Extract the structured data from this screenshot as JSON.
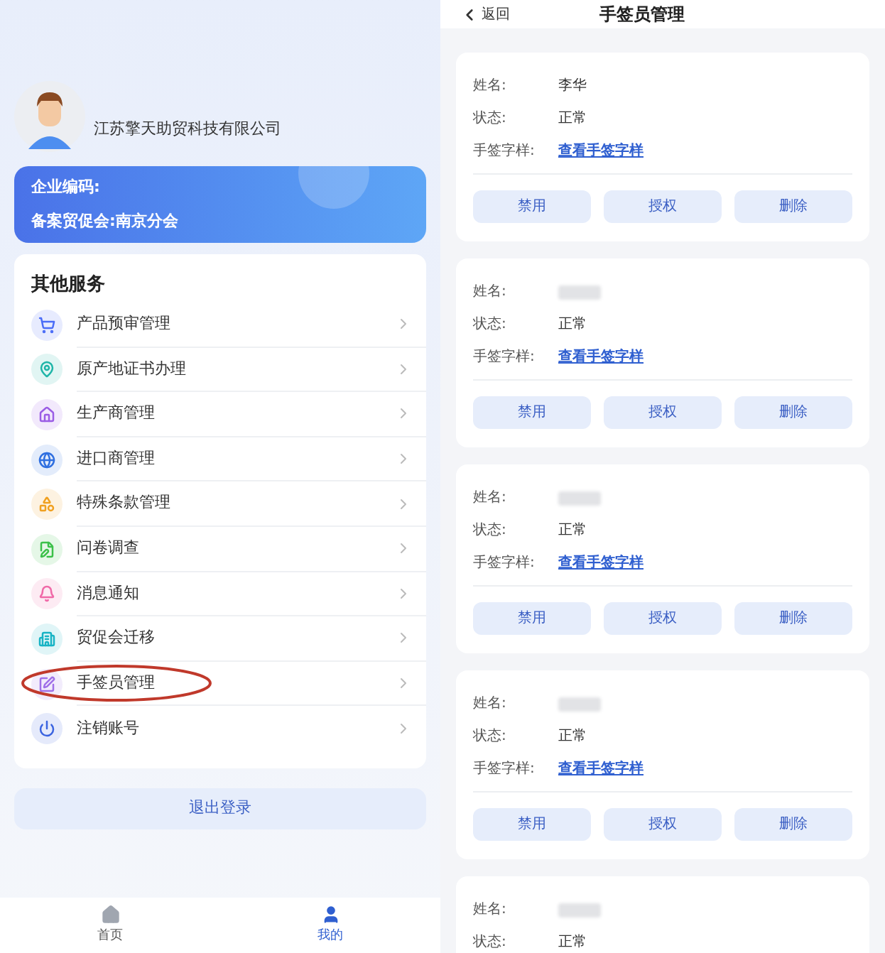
{
  "profile": {
    "company": "江苏擎天助贸科技有限公司",
    "enterprise_code_label": "企业编码:",
    "chamber_label": "备案贸促会:",
    "chamber_value": "南京分会"
  },
  "services": {
    "title": "其他服务",
    "items": [
      {
        "label": "产品预审管理",
        "color": "#4a6cf7",
        "highlighted": false
      },
      {
        "label": "原产地证书办理",
        "color": "#1fb5a8",
        "highlighted": false
      },
      {
        "label": "生产商管理",
        "color": "#9b5de5",
        "highlighted": false
      },
      {
        "label": "进口商管理",
        "color": "#2f6fe0",
        "highlighted": false
      },
      {
        "label": "特殊条款管理",
        "color": "#f0a020",
        "highlighted": false
      },
      {
        "label": "问卷调查",
        "color": "#3cc04a",
        "highlighted": false
      },
      {
        "label": "消息通知",
        "color": "#f06aa8",
        "highlighted": false
      },
      {
        "label": "贸促会迁移",
        "color": "#17b3c4",
        "highlighted": false
      },
      {
        "label": "手签员管理",
        "color": "#a070e8",
        "highlighted": true
      },
      {
        "label": "注销账号",
        "color": "#3a63e0",
        "highlighted": false
      }
    ]
  },
  "logout_button": "退出登录",
  "bottom_nav": [
    {
      "label": "首页",
      "selected": false
    },
    {
      "label": "我的",
      "selected": true
    }
  ],
  "signer_page": {
    "back": "返回",
    "title": "手签员管理",
    "signers": [
      {
        "name_label": "姓名:",
        "name": "李华",
        "status_label": "状态:",
        "status": "正常",
        "sample_label": "手签字样:",
        "sample_link": "查看手签字样",
        "buttons": [
          "禁用",
          "授权",
          "删除"
        ]
      },
      {
        "name_label": "姓名:",
        "status_label": "状态:",
        "status": "正常",
        "sample_label": "手签字样:",
        "sample_link": "查看手签字样",
        "buttons": [
          "禁用",
          "授权",
          "删除"
        ]
      },
      {
        "name_label": "姓名:",
        "status_label": "状态:",
        "status": "正常",
        "sample_label": "手签字样:",
        "sample_link": "查看手签字样",
        "buttons": [
          "禁用",
          "授权",
          "删除"
        ]
      },
      {
        "name_label": "姓名:",
        "status_label": "状态:",
        "status": "正常",
        "sample_label": "手签字样:",
        "sample_link": "查看手签字样",
        "buttons": [
          "禁用",
          "授权",
          "删除"
        ]
      },
      {
        "name_label": "姓名:",
        "status_label": "状态:",
        "status": "正常"
      }
    ]
  }
}
